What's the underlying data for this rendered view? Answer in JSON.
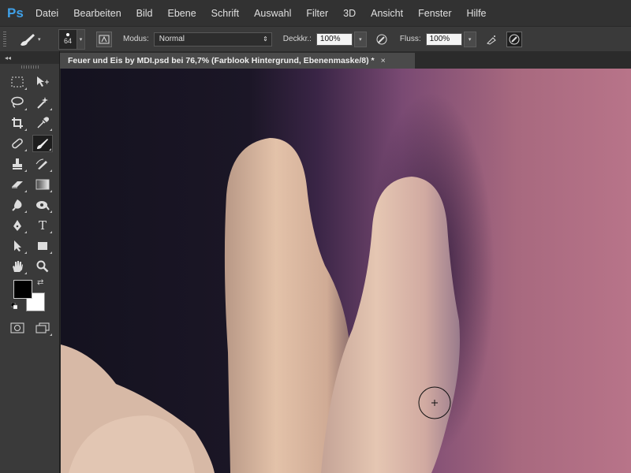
{
  "app": {
    "logo": "Ps"
  },
  "menu": [
    "Datei",
    "Bearbeiten",
    "Bild",
    "Ebene",
    "Schrift",
    "Auswahl",
    "Filter",
    "3D",
    "Ansicht",
    "Fenster",
    "Hilfe"
  ],
  "options": {
    "brush_size": "64",
    "mode_label": "Modus:",
    "mode_value": "Normal",
    "opacity_label": "Deckkr.:",
    "opacity_value": "100%",
    "flow_label": "Fluss:",
    "flow_value": "100%"
  },
  "document": {
    "tab_title": "Feuer und Eis by MDI.psd bei 76,7% (Farblook Hintergrund, Ebenenmaske/8) *",
    "close": "×"
  },
  "toolbox": {
    "collapse": "◂◂"
  },
  "colors": {
    "foreground": "#000000",
    "background": "#ffffff",
    "accent": "#3fa0e8"
  }
}
